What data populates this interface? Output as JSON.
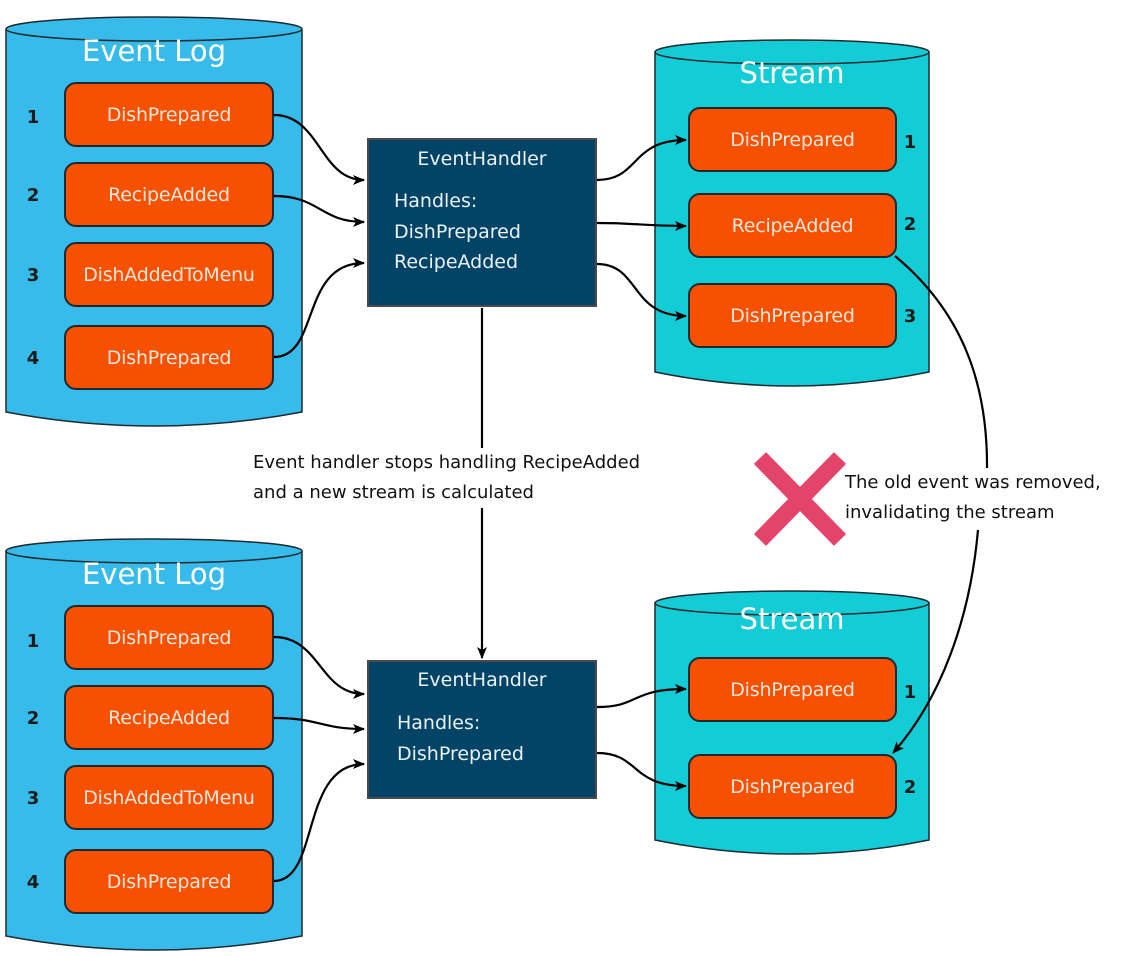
{
  "colors": {
    "event_log_fill": "#36bbea",
    "stream_fill": "#14ccd5",
    "event_fill": "#f75000",
    "handler_fill": "#034466",
    "invalid_mark": "#e4446a"
  },
  "top": {
    "event_log": {
      "title": "Event Log",
      "events": [
        {
          "index": "1",
          "name": "DishPrepared"
        },
        {
          "index": "2",
          "name": "RecipeAdded"
        },
        {
          "index": "3",
          "name": "DishAddedToMenu"
        },
        {
          "index": "4",
          "name": "DishPrepared"
        }
      ]
    },
    "handler": {
      "title": "EventHandler",
      "handles_label": "Handles:",
      "handles": [
        "DishPrepared",
        "RecipeAdded"
      ]
    },
    "stream": {
      "title": "Stream",
      "events": [
        {
          "index": "1",
          "name": "DishPrepared"
        },
        {
          "index": "2",
          "name": "RecipeAdded"
        },
        {
          "index": "3",
          "name": "DishPrepared"
        }
      ]
    }
  },
  "middle": {
    "transition_note": [
      "Event handler stops handling RecipeAdded",
      "and a new stream is calculated"
    ],
    "invalidation_note": [
      "The old event was removed,",
      "invalidating the stream"
    ],
    "invalid_icon": "x-mark-icon"
  },
  "bottom": {
    "event_log": {
      "title": "Event Log",
      "events": [
        {
          "index": "1",
          "name": "DishPrepared"
        },
        {
          "index": "2",
          "name": "RecipeAdded"
        },
        {
          "index": "3",
          "name": "DishAddedToMenu"
        },
        {
          "index": "4",
          "name": "DishPrepared"
        }
      ]
    },
    "handler": {
      "title": "EventHandler",
      "handles_label": "Handles:",
      "handles": [
        "DishPrepared"
      ]
    },
    "stream": {
      "title": "Stream",
      "events": [
        {
          "index": "1",
          "name": "DishPrepared"
        },
        {
          "index": "2",
          "name": "DishPrepared"
        }
      ]
    }
  }
}
